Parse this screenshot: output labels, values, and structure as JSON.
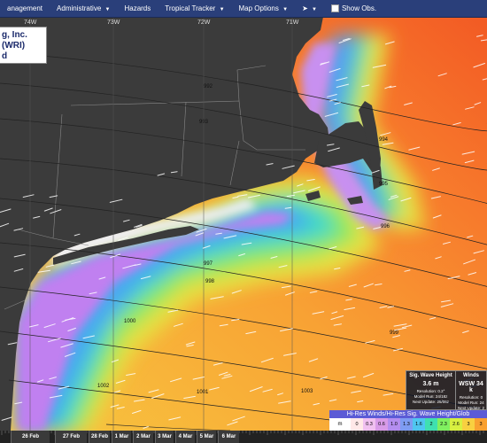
{
  "navbar": {
    "items": [
      {
        "label": "anagement",
        "caret": ""
      },
      {
        "label": "Administrative",
        "caret": "▼"
      },
      {
        "label": "Hazards",
        "caret": ""
      },
      {
        "label": "Tropical Tracker",
        "caret": "▼"
      },
      {
        "label": "Map Options",
        "caret": "▼"
      },
      {
        "label": "➤",
        "caret": "▼"
      },
      {
        "label": "Show Obs.",
        "caret": ""
      }
    ]
  },
  "map": {
    "longitude_labels": [
      "74W",
      "73W",
      "72W",
      "71W"
    ],
    "isobar_labels": [
      "992",
      "993",
      "994",
      "995",
      "996",
      "997",
      "998",
      "999",
      "1000",
      "1001",
      "1002",
      "1003"
    ]
  },
  "title_box": {
    "line1": "g, Inc. (WRI)",
    "line2": "d"
  },
  "info_box": {
    "wave_header": "Sig. Wave Height",
    "wave_value": "3.6 m",
    "wave_resolution": "Resolution: 0.2°",
    "wave_model_run": "Model Run: 24/18z",
    "wave_next_update": "Next Update: 25/06z",
    "wind_header": "Winds",
    "wind_value": "WSW 34 k",
    "wind_resolution": "Resolution: 0",
    "wind_model_run": "Model Run: 24",
    "wind_next_update": "Next Update: 2"
  },
  "legend": {
    "title": "Hi-Res Winds/Hi-Res Sig. Wave Height/Glob",
    "unit": "m",
    "values": [
      "0",
      "0.3",
      "0.6",
      "1.0",
      "1.3",
      "1.6",
      "2",
      "2.3",
      "2.6",
      "3",
      "3"
    ],
    "colors": [
      "#ffe8e8",
      "#f0c0f0",
      "#d89be8",
      "#b48ef0",
      "#7e9cf2",
      "#4fc6f0",
      "#3fe0b0",
      "#80f060",
      "#d8f040",
      "#f8d040",
      "#f8a030"
    ]
  },
  "timeline": {
    "labels": [
      "26 Feb",
      "27 Feb",
      "28 Feb",
      "1 Mar",
      "2 Mar",
      "3 Mar",
      "4 Mar",
      "5 Mar",
      "6 Mar"
    ]
  }
}
